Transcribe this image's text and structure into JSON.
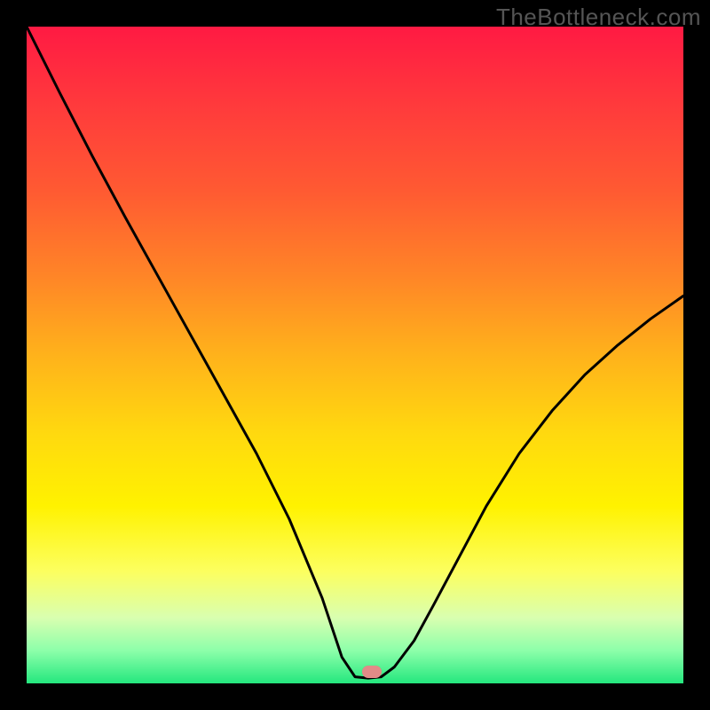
{
  "watermark": "TheBottleneck.com",
  "gradient_stops": [
    {
      "offset": 0.0,
      "color": "#ff1a43"
    },
    {
      "offset": 0.12,
      "color": "#ff3a3c"
    },
    {
      "offset": 0.25,
      "color": "#ff5a32"
    },
    {
      "offset": 0.38,
      "color": "#ff8527"
    },
    {
      "offset": 0.5,
      "color": "#ffb21b"
    },
    {
      "offset": 0.62,
      "color": "#ffd90f"
    },
    {
      "offset": 0.73,
      "color": "#fff200"
    },
    {
      "offset": 0.83,
      "color": "#fcff60"
    },
    {
      "offset": 0.9,
      "color": "#d9ffb0"
    },
    {
      "offset": 0.95,
      "color": "#8dffaa"
    },
    {
      "offset": 1.0,
      "color": "#24e77e"
    }
  ],
  "marker": {
    "x_frac": 0.525,
    "y_frac": 0.982,
    "color": "#e28b88"
  },
  "chart_data": {
    "type": "line",
    "title": "",
    "xlabel": "",
    "ylabel": "",
    "xlim": [
      0,
      1
    ],
    "ylim": [
      0,
      1
    ],
    "series": [
      {
        "name": "curve",
        "x": [
          0.0,
          0.05,
          0.1,
          0.15,
          0.2,
          0.25,
          0.3,
          0.35,
          0.4,
          0.45,
          0.48,
          0.5,
          0.52,
          0.54,
          0.56,
          0.59,
          0.62,
          0.66,
          0.7,
          0.75,
          0.8,
          0.85,
          0.9,
          0.95,
          1.0
        ],
        "y": [
          1.0,
          0.9,
          0.803,
          0.71,
          0.62,
          0.53,
          0.44,
          0.35,
          0.25,
          0.13,
          0.04,
          0.01,
          0.008,
          0.01,
          0.025,
          0.065,
          0.12,
          0.195,
          0.27,
          0.35,
          0.415,
          0.47,
          0.515,
          0.555,
          0.59
        ]
      }
    ]
  }
}
